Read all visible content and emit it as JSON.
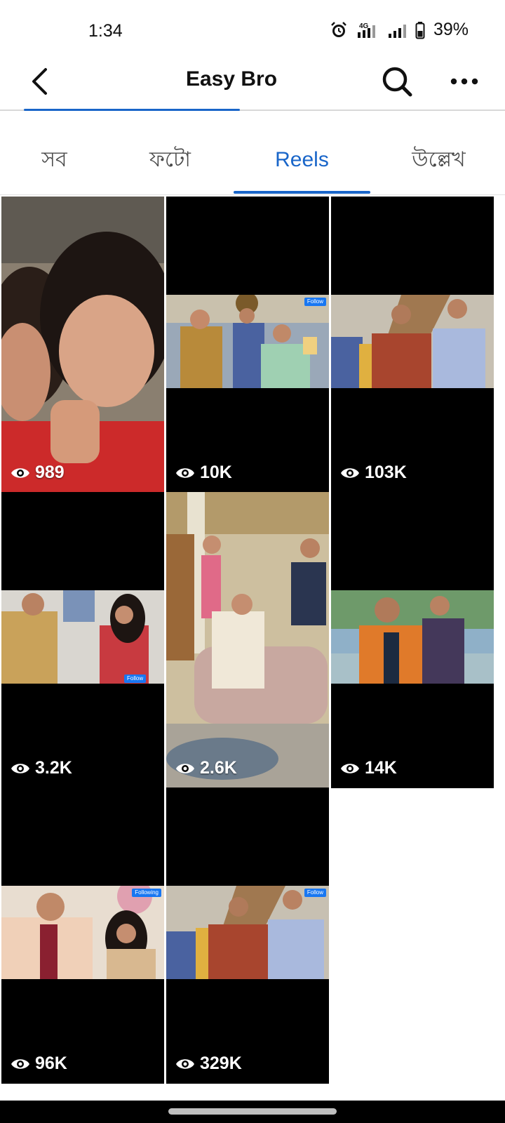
{
  "status_bar": {
    "time": "1:34",
    "battery": "39%",
    "icons": [
      "alarm-icon",
      "4g-signal-icon",
      "cell-signal-icon",
      "battery-icon"
    ]
  },
  "app_bar": {
    "title": "Easy Bro",
    "icons": [
      "back-arrow-icon",
      "search-icon",
      "more-dots-icon"
    ]
  },
  "tabs": [
    {
      "label": "সব",
      "active": false
    },
    {
      "label": "ফটো",
      "active": false
    },
    {
      "label": "Reels",
      "active": true
    },
    {
      "label": "উল্লেখ",
      "active": false
    }
  ],
  "reels": [
    {
      "views": "989",
      "thumb": "selfie"
    },
    {
      "views": "10K",
      "thumb": "family-room",
      "badge": "Follow"
    },
    {
      "views": "103K",
      "thumb": "staircase-group"
    },
    {
      "views": "3.2K",
      "thumb": "portrait-room",
      "badge": "Follow"
    },
    {
      "views": "2.6K",
      "thumb": "living-room"
    },
    {
      "views": "14K",
      "thumb": "outdoor"
    },
    {
      "views": "96K",
      "thumb": "hall-couple",
      "badge": "Following"
    },
    {
      "views": "329K",
      "thumb": "staircase-group-2",
      "badge": "Follow"
    }
  ],
  "colors": {
    "accent": "#1a66c9",
    "tile_background": "#000000",
    "badge": "#1877f2"
  }
}
